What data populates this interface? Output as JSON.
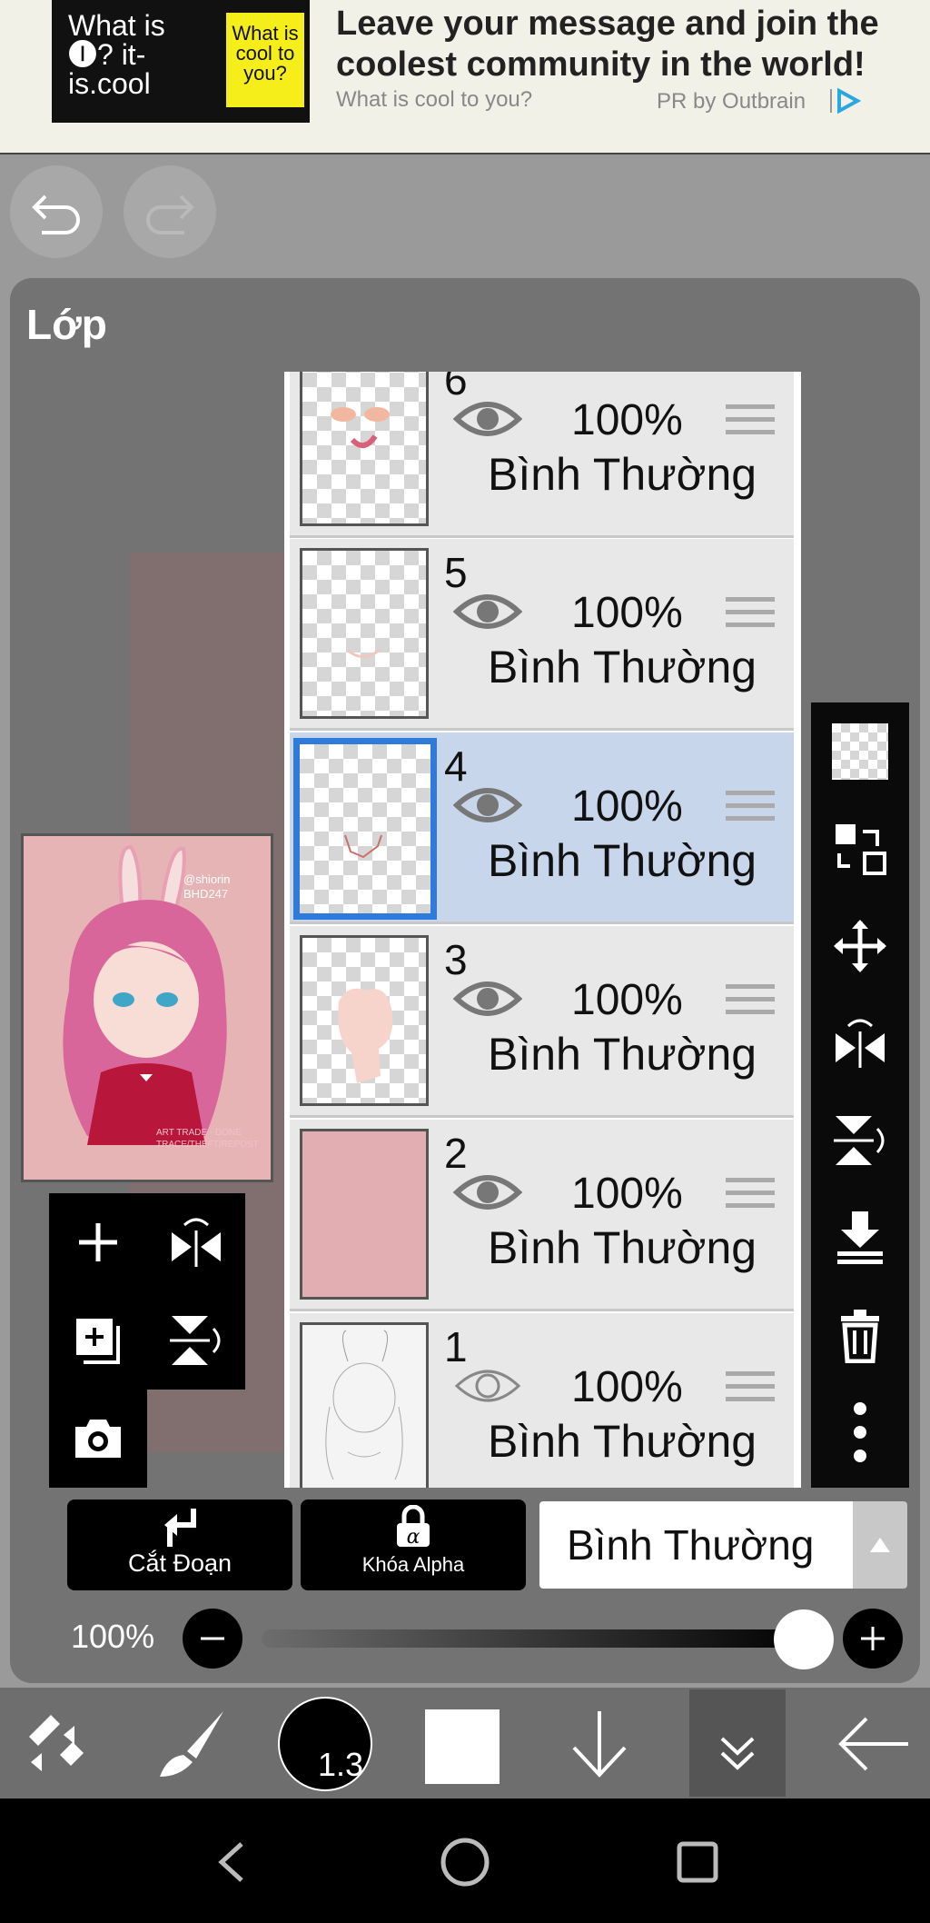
{
  "ad": {
    "logo_left": "What is 🅘? it-is.cool",
    "logo_yellow": "What is cool to you?",
    "headline": "Leave your message and join the coolest community in the world!",
    "subline": "What is cool to you?",
    "sponsor": "PR by Outbrain"
  },
  "panel": {
    "title": "Lớp"
  },
  "layers": [
    {
      "num": "6",
      "opacity": "100%",
      "mode": "Bình Thường",
      "selected": false
    },
    {
      "num": "5",
      "opacity": "100%",
      "mode": "Bình Thường",
      "selected": false
    },
    {
      "num": "4",
      "opacity": "100%",
      "mode": "Bình Thường",
      "selected": true
    },
    {
      "num": "3",
      "opacity": "100%",
      "mode": "Bình Thường",
      "selected": false
    },
    {
      "num": "2",
      "opacity": "100%",
      "mode": "Bình Thường",
      "selected": false
    },
    {
      "num": "1",
      "opacity": "100%",
      "mode": "Bình Thường",
      "selected": false
    }
  ],
  "preview": {
    "watermark": "@shiorin\nBHD247",
    "footer": "ART TRADE - DONE\nTRACE/THEFT/REPOST"
  },
  "actions": {
    "clip_label": "Cắt Đoạn",
    "alpha_label": "Khóa Alpha",
    "blend_mode": "Bình Thường"
  },
  "opacity": {
    "label": "100%",
    "value": 1.0
  },
  "brush_size": "1.3",
  "colors": {
    "panel": "#737373",
    "selected_row": "#c8d6ec",
    "accent": "#2f7bdc",
    "layer2_fill": "#e3aeb1"
  }
}
